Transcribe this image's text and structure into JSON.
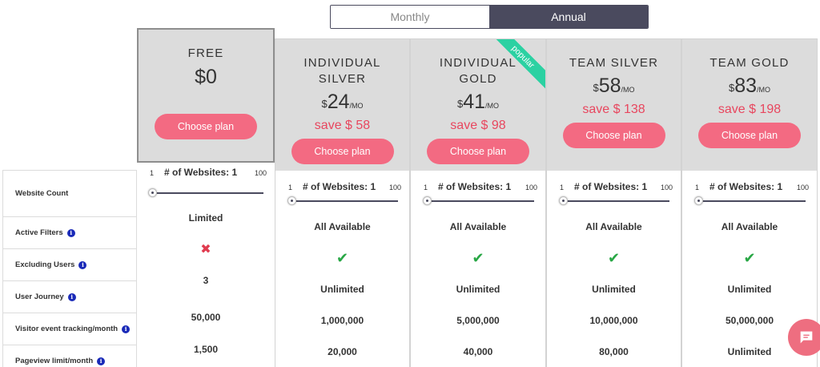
{
  "toggle": {
    "monthly": "Monthly",
    "annual": "Annual"
  },
  "rows": {
    "website_count": "Website Count",
    "active_filters": "Active Filters",
    "excluding_users": "Excluding Users",
    "user_journey": "User Journey",
    "visitor_tracking": "Visitor event tracking/month",
    "pageview_limit": "Pageview limit/month"
  },
  "slider": {
    "min": "1",
    "max": "100",
    "label": "# of Websites: 1"
  },
  "plans": [
    {
      "name": "FREE",
      "price": "$0",
      "button": "Choose plan",
      "active_filters": "Limited",
      "user_journey": "3",
      "visitor_tracking": "50,000",
      "pageview": "1,500"
    },
    {
      "name_line1": "INDIVIDUAL",
      "name_line2": "SILVER",
      "currency": "$",
      "amount": "24",
      "unit": "/MO",
      "save": "save $ 58",
      "button": "Choose plan",
      "active_filters": "All Available",
      "user_journey": "Unlimited",
      "visitor_tracking": "1,000,000",
      "pageview": "20,000"
    },
    {
      "name_line1": "INDIVIDUAL",
      "name_line2": "GOLD",
      "currency": "$",
      "amount": "41",
      "unit": "/MO",
      "save": "save $ 98",
      "button": "Choose plan",
      "ribbon": "popular",
      "active_filters": "All Available",
      "user_journey": "Unlimited",
      "visitor_tracking": "5,000,000",
      "pageview": "40,000"
    },
    {
      "name": "TEAM SILVER",
      "currency": "$",
      "amount": "58",
      "unit": "/MO",
      "save": "save $ 138",
      "button": "Choose plan",
      "active_filters": "All Available",
      "user_journey": "Unlimited",
      "visitor_tracking": "10,000,000",
      "pageview": "80,000"
    },
    {
      "name": "TEAM GOLD",
      "currency": "$",
      "amount": "83",
      "unit": "/MO",
      "save": "save $ 198",
      "button": "Choose plan",
      "active_filters": "All Available",
      "user_journey": "Unlimited",
      "visitor_tracking": "50,000,000",
      "pageview": "Unlimited"
    }
  ],
  "icons": {
    "info": "info-icon",
    "cross": "cross-icon",
    "check": "check-icon",
    "chat": "chat-icon"
  },
  "colors": {
    "accent": "#f36a82",
    "save": "#e8465e",
    "ribbon": "#2bd1a2",
    "dark": "#4a4a5e",
    "check": "#28a745",
    "cross": "#e03b4f"
  }
}
